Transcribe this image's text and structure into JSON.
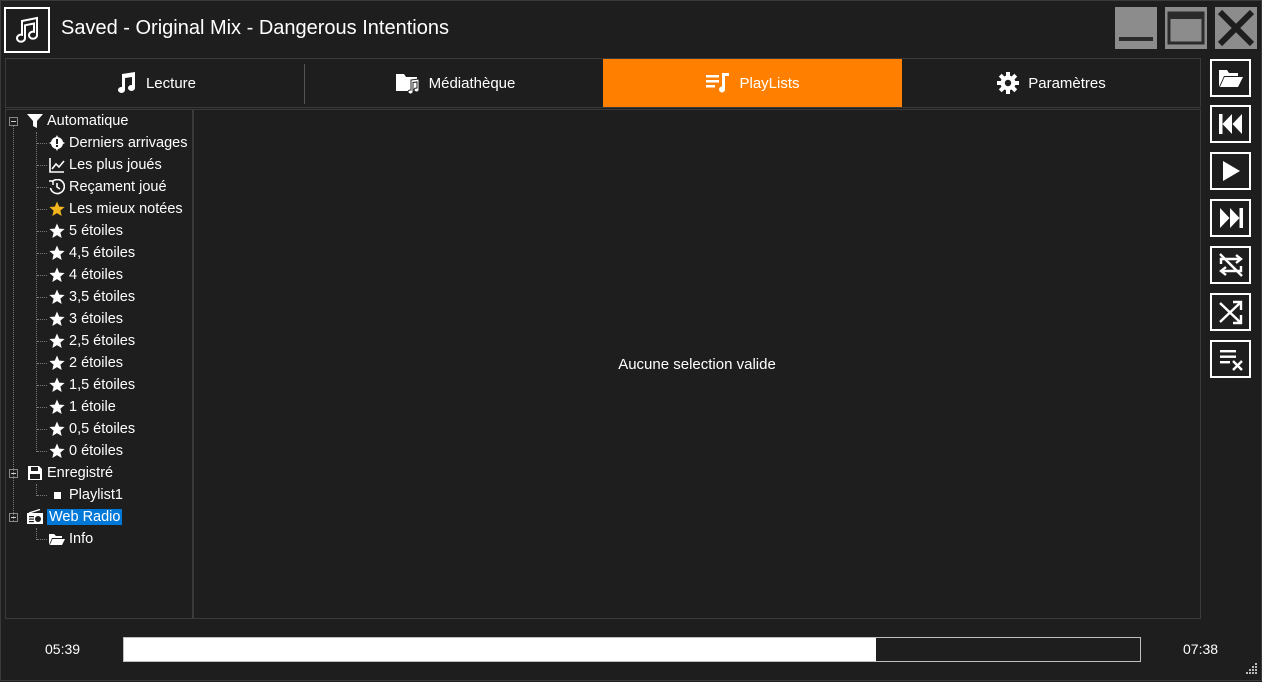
{
  "window": {
    "title": "Saved - Original Mix - Dangerous Intentions",
    "icon": "music-note-icon",
    "controls": [
      "minimize-icon",
      "maximize-icon",
      "close-icon"
    ]
  },
  "tabs": [
    {
      "label": "Lecture",
      "icon": "music-note-icon",
      "active": false
    },
    {
      "label": "Médiathèque",
      "icon": "music-folder-icon",
      "active": false
    },
    {
      "label": "PlayLists",
      "icon": "playlist-icon",
      "active": true
    },
    {
      "label": "Paramètres",
      "icon": "gear-icon",
      "active": false
    }
  ],
  "tree": {
    "automatic": {
      "label": "Automatique",
      "icon": "filter-icon",
      "items": [
        {
          "label": "Derniers arrivages",
          "icon": "badge-icon"
        },
        {
          "label": "Les plus joués",
          "icon": "chart-line-icon"
        },
        {
          "label": "Reçament joué",
          "icon": "history-icon"
        },
        {
          "label": "Les mieux notées",
          "icon": "gold-star-icon"
        },
        {
          "label": "5 étoiles",
          "icon": "star-icon"
        },
        {
          "label": "4,5 étoiles",
          "icon": "star-icon"
        },
        {
          "label": "4 étoiles",
          "icon": "star-icon"
        },
        {
          "label": "3,5 étoiles",
          "icon": "star-icon"
        },
        {
          "label": "3 étoiles",
          "icon": "star-icon"
        },
        {
          "label": "2,5 étoiles",
          "icon": "star-icon"
        },
        {
          "label": "2 étoiles",
          "icon": "star-icon"
        },
        {
          "label": "1,5 étoiles",
          "icon": "star-icon"
        },
        {
          "label": "1 étoile",
          "icon": "star-icon"
        },
        {
          "label": "0,5 étoiles",
          "icon": "star-icon"
        },
        {
          "label": "0 étoiles",
          "icon": "star-icon"
        }
      ]
    },
    "saved": {
      "label": "Enregistré",
      "icon": "floppy-icon",
      "items": [
        {
          "label": "Playlist1",
          "icon": "square-icon"
        }
      ]
    },
    "webradio": {
      "label": "Web Radio",
      "icon": "radio-icon",
      "selected": true,
      "items": [
        {
          "label": "Info",
          "icon": "folder-open-icon"
        }
      ]
    }
  },
  "main": {
    "empty_message": "Aucune selection valide"
  },
  "controls": [
    "open-folder-icon",
    "previous-icon",
    "play-icon",
    "next-icon",
    "repeat-off-icon",
    "shuffle-icon",
    "clear-playlist-icon"
  ],
  "player": {
    "elapsed": "05:39",
    "total": "07:38",
    "progress_fraction": 0.74
  },
  "colors": {
    "accent": "#ff8000",
    "background": "#1e1e1e",
    "selection": "#0078d7",
    "gold": "#f2b61c"
  }
}
